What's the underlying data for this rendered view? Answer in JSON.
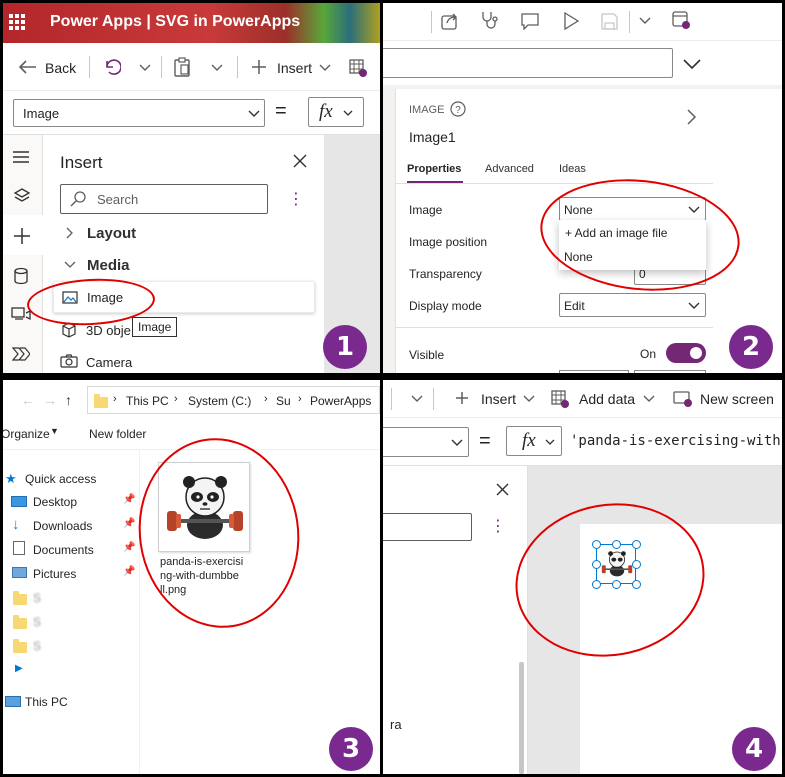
{
  "panel1": {
    "app_title": "Power Apps  |  SVG in PowerApps",
    "back_label": "Back",
    "insert_label": "Insert",
    "property_select": "Image",
    "equals": "=",
    "fx": "fx",
    "insert_pane_title": "Insert",
    "search_placeholder": "Search",
    "groups": [
      "Layout",
      "Media"
    ],
    "media_items": [
      "Image",
      "3D obje",
      "Camera"
    ],
    "tooltip": "Image",
    "badge": "1"
  },
  "panel2": {
    "control_type": "IMAGE",
    "control_name": "Image1",
    "tabs": [
      "Properties",
      "Advanced",
      "Ideas"
    ],
    "properties": {
      "image_label": "Image",
      "image_value": "None",
      "image_position_label": "Image position",
      "transparency_label": "Transparency",
      "transparency_value": "0",
      "display_mode_label": "Display mode",
      "display_mode_value": "Edit",
      "visible_label": "Visible",
      "visible_value": "On"
    },
    "dropdown_options": [
      "+ Add an image file",
      "None"
    ],
    "badge": "2"
  },
  "panel3": {
    "breadcrumb": [
      "This PC",
      "System (C:)",
      "Su",
      "PowerApps"
    ],
    "organize_label": "Organize",
    "new_folder_label": "New folder",
    "quick_access_label": "Quick access",
    "nav_items": [
      "Desktop",
      "Downloads",
      "Documents",
      "Pictures",
      "S",
      "S",
      "S",
      ""
    ],
    "this_pc_label": "This PC",
    "file_name": "panda-is-exercising-with-dumbbell.png",
    "file_name_lines": [
      "panda-is-exercisi",
      "ng-with-dumbbe",
      "ll.png"
    ],
    "badge": "3"
  },
  "panel4": {
    "insert_label": "Insert",
    "add_data_label": "Add data",
    "new_screen_label": "New screen",
    "equals": "=",
    "fx": "fx",
    "formula_value": "'panda-is-exercising-with-",
    "left_fragment": "ra",
    "badge": "4"
  },
  "colors": {
    "accent_purple": "#742774",
    "badge_purple": "#7a2a8e",
    "annotation_red": "#e00000",
    "selection_blue": "#0078d4"
  }
}
